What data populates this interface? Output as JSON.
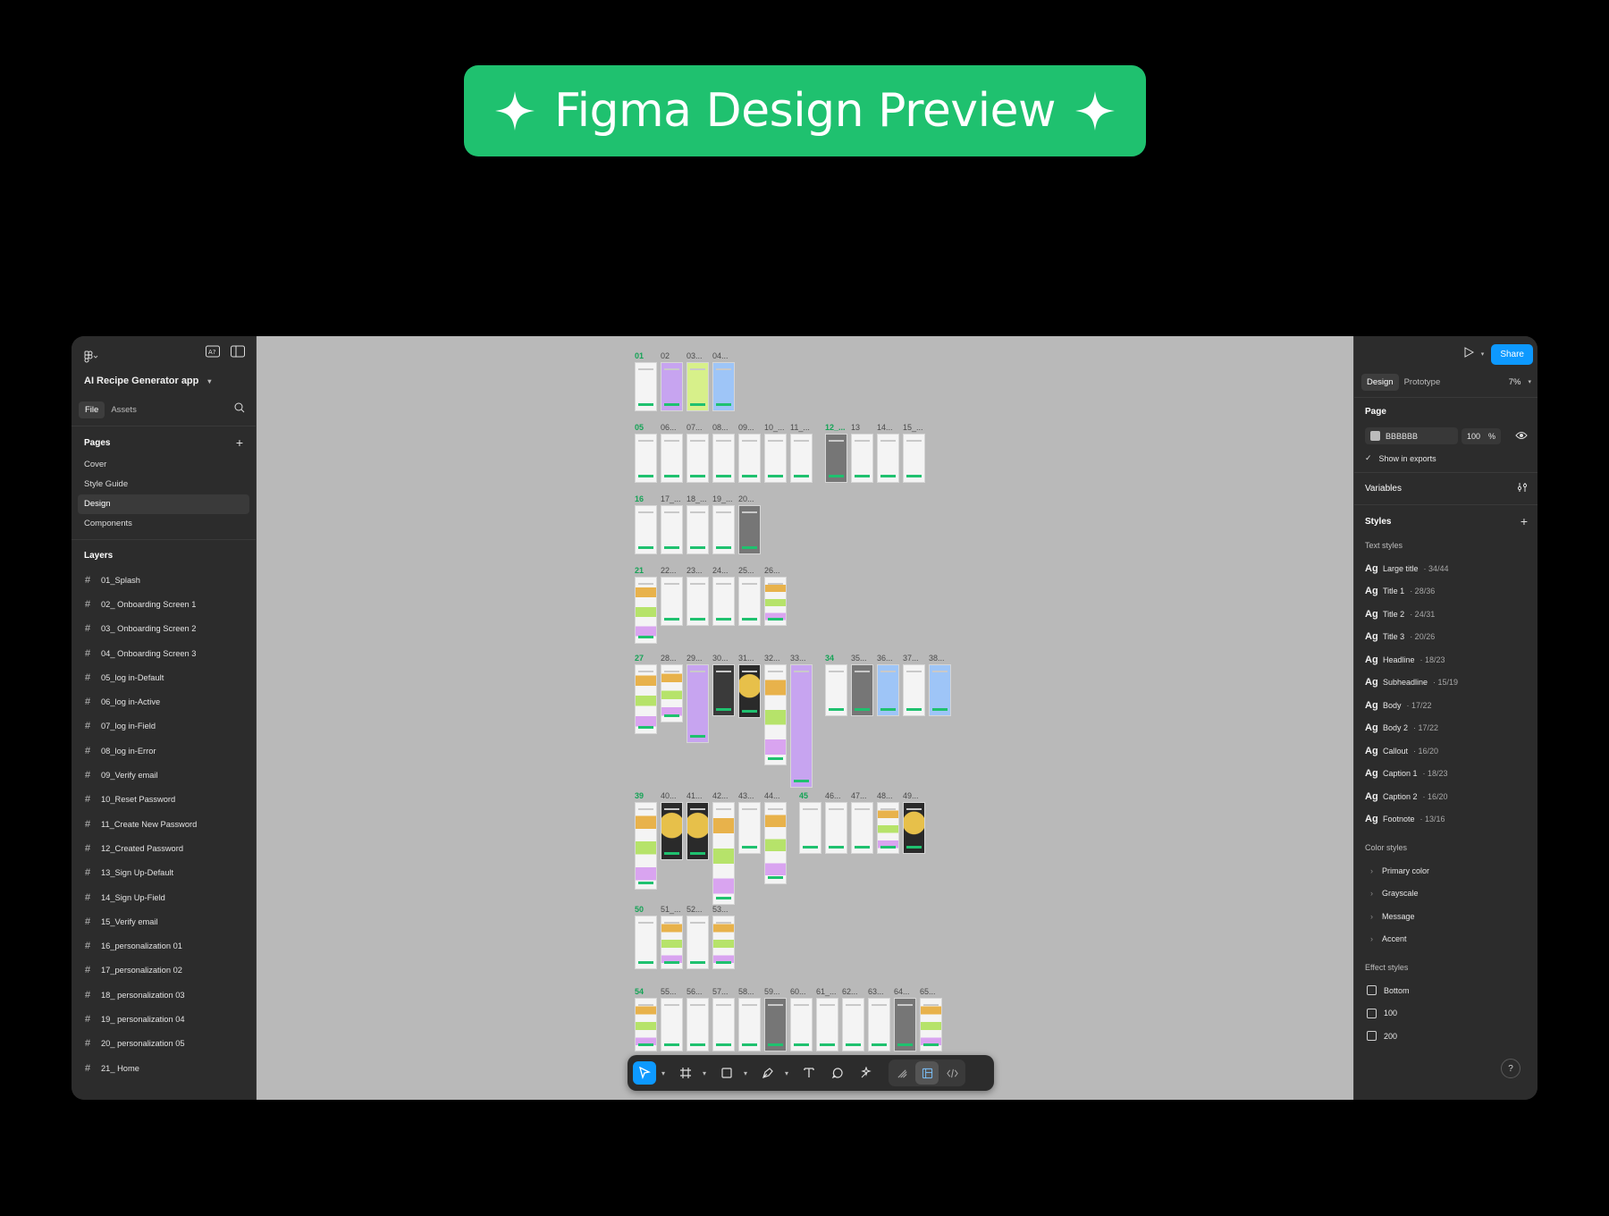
{
  "banner": {
    "title": "Figma Design Preview"
  },
  "app": {
    "project_name": "AI Recipe Generator app",
    "tabs": [
      "File",
      "Assets"
    ],
    "pages_header": "Pages",
    "pages": [
      "Cover",
      "Style Guide",
      "Design",
      "Components"
    ],
    "active_page": "Design",
    "layers_header": "Layers",
    "layers": [
      "01_Splash",
      "02_ Onboarding Screen 1",
      "03_ Onboarding Screen 2",
      "04_ Onboarding Screen 3",
      "05_log in-Default",
      "06_log in-Active",
      "07_log in-Field",
      "08_log in-Error",
      "09_Verify email",
      "10_Reset Password",
      "11_Create New Password",
      "12_Created Password",
      "13_Sign Up-Default",
      "14_Sign Up-Field",
      "15_Verify email",
      "16_personalization 01",
      "17_personalization 02",
      "18_ personalization 03",
      "19_ personalization 04",
      "20_ personalization 05",
      "21_ Home"
    ]
  },
  "right_panel": {
    "share_label": "Share",
    "tabs": [
      "Design",
      "Prototype"
    ],
    "zoom": "7%",
    "page_header": "Page",
    "page_color": "BBBBBB",
    "page_opacity": "100",
    "page_opacity_unit": "%",
    "show_in_exports": "Show in exports",
    "variables_header": "Variables",
    "styles_header": "Styles",
    "text_styles_header": "Text styles",
    "text_styles": [
      {
        "name": "Large title",
        "size": " · 34/44"
      },
      {
        "name": "Title 1",
        "size": " · 28/36"
      },
      {
        "name": "Title 2",
        "size": " · 24/31"
      },
      {
        "name": "Title 3",
        "size": " · 20/26"
      },
      {
        "name": "Headline",
        "size": " · 18/23"
      },
      {
        "name": "Subheadline",
        "size": " · 15/19"
      },
      {
        "name": "Body",
        "size": " · 17/22"
      },
      {
        "name": "Body 2",
        "size": " · 17/22"
      },
      {
        "name": "Callout",
        "size": " · 16/20"
      },
      {
        "name": "Caption 1",
        "size": " · 18/23"
      },
      {
        "name": "Caption 2",
        "size": " · 16/20"
      },
      {
        "name": "Footnote",
        "size": " · 13/16"
      }
    ],
    "color_styles_header": "Color styles",
    "color_styles": [
      "Primary color",
      "Grayscale",
      "Message",
      "Accent"
    ],
    "effect_styles_header": "Effect styles",
    "effect_styles": [
      "Bottom",
      "100",
      "200"
    ],
    "help": "?"
  },
  "canvas": {
    "background": "#BBBBBB",
    "rows": [
      {
        "labels": [
          "01",
          "02",
          "03...",
          "04..."
        ]
      },
      {
        "labels": [
          "05",
          "06...",
          "07...",
          "08...",
          "09...",
          "10_...",
          "11_...",
          "12_...",
          "13",
          "14...",
          "15_..."
        ]
      },
      {
        "labels": [
          "16",
          "17_...",
          "18_...",
          "19_...",
          "20..."
        ]
      },
      {
        "labels": [
          "21",
          "22...",
          "23...",
          "24...",
          "25...",
          "26..."
        ]
      },
      {
        "labels": [
          "27",
          "28...",
          "29...",
          "30...",
          "31...",
          "32...",
          "33...",
          "34",
          "35...",
          "36...",
          "37...",
          "38..."
        ]
      },
      {
        "labels": [
          "39",
          "40...",
          "41...",
          "42...",
          "43...",
          "44...",
          "45",
          "46...",
          "47...",
          "48...",
          "49..."
        ]
      },
      {
        "labels": [
          "50",
          "51_...",
          "52...",
          "53..."
        ]
      },
      {
        "labels": [
          "54",
          "55...",
          "56...",
          "57...",
          "58...",
          "59...",
          "60...",
          "61_...",
          "62...",
          "63...",
          "64...",
          "65..."
        ]
      }
    ]
  },
  "colors": {
    "accent_green": "#1FC16F",
    "share_blue": "#0D99FF",
    "canvas": "#BBBBBB"
  }
}
